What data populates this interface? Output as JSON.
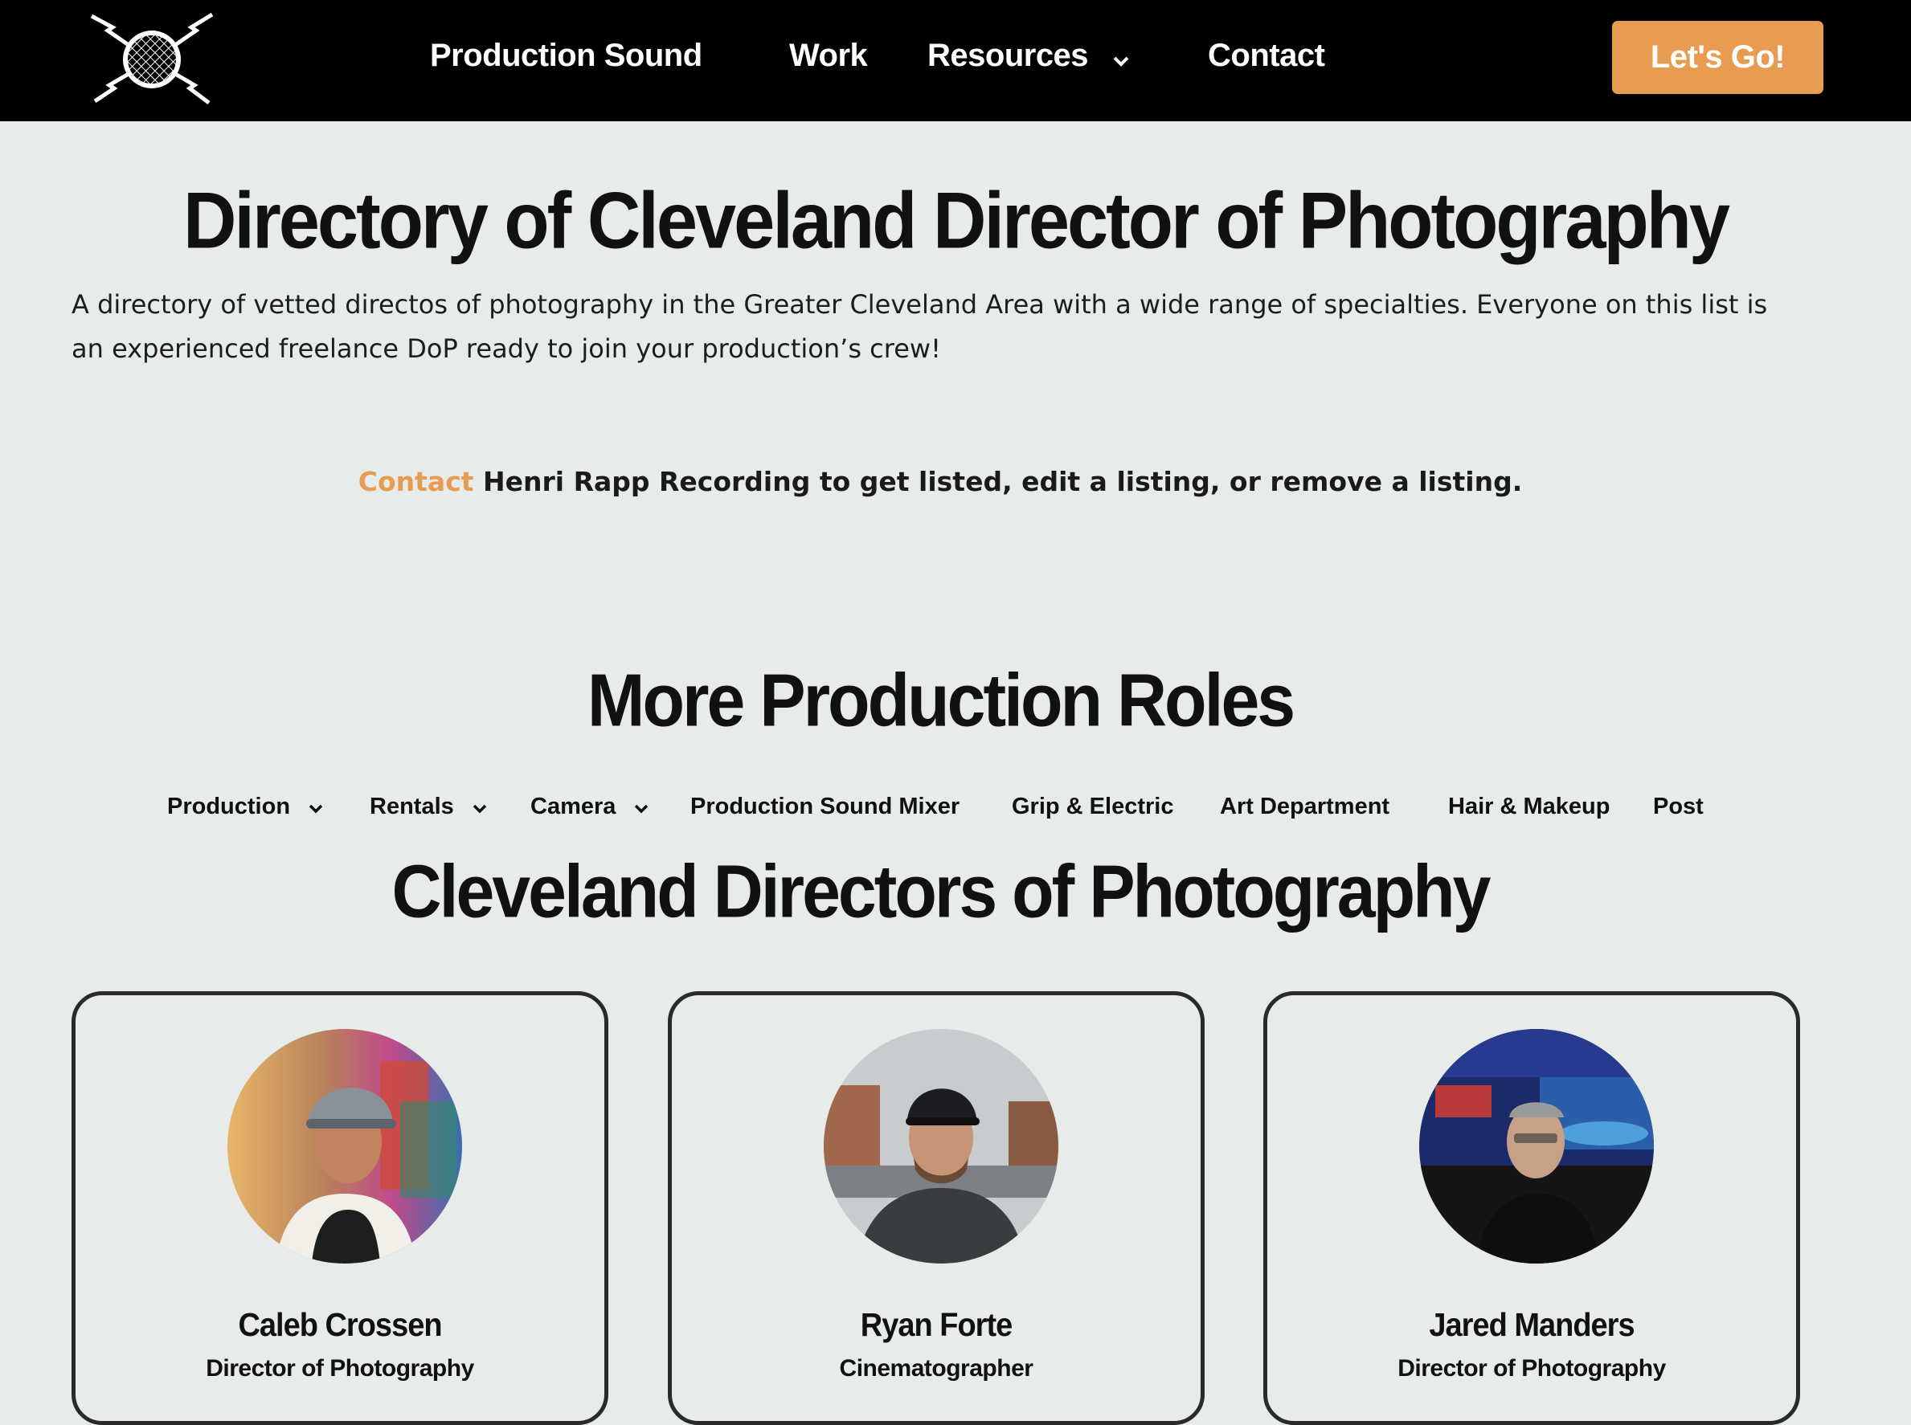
{
  "header": {
    "nav": [
      {
        "label": "Production Sound",
        "has_dropdown": false
      },
      {
        "label": "Work",
        "has_dropdown": false
      },
      {
        "label": "Resources",
        "has_dropdown": true
      },
      {
        "label": "Contact",
        "has_dropdown": false
      }
    ],
    "cta_label": "Let's Go!",
    "logo_icon": "microphone-lightning-logo"
  },
  "main": {
    "title": "Directory of Cleveland Director of Photography",
    "intro": "A directory of vetted directos of photography in the Greater Cleveland Area with a wide range of specialties. Everyone on this list is an experienced freelance DoP ready to join your production’s crew!",
    "contact_link": "Contact",
    "contact_rest": " Henri Rapp Recording to get listed, edit a listing, or remove a listing."
  },
  "roles": {
    "heading": "More Production Roles",
    "items": [
      {
        "label": "Production",
        "has_dropdown": true
      },
      {
        "label": "Rentals",
        "has_dropdown": true
      },
      {
        "label": "Camera",
        "has_dropdown": true
      },
      {
        "label": "Production Sound Mixer",
        "has_dropdown": false
      },
      {
        "label": "Grip & Electric",
        "has_dropdown": false
      },
      {
        "label": "Art Department",
        "has_dropdown": false
      },
      {
        "label": "Hair & Makeup",
        "has_dropdown": false
      },
      {
        "label": "Post",
        "has_dropdown": false
      }
    ]
  },
  "directory": {
    "heading": "Cleveland Directors of Photography",
    "people": [
      {
        "name": "Caleb Crossen",
        "title": "Director of Photography"
      },
      {
        "name": "Ryan Forte",
        "title": "Cinematographer"
      },
      {
        "name": "Jared Manders",
        "title": "Director of Photography"
      }
    ]
  },
  "colors": {
    "accent": "#e89c52",
    "background": "#e7eceb",
    "header": "#000000"
  }
}
